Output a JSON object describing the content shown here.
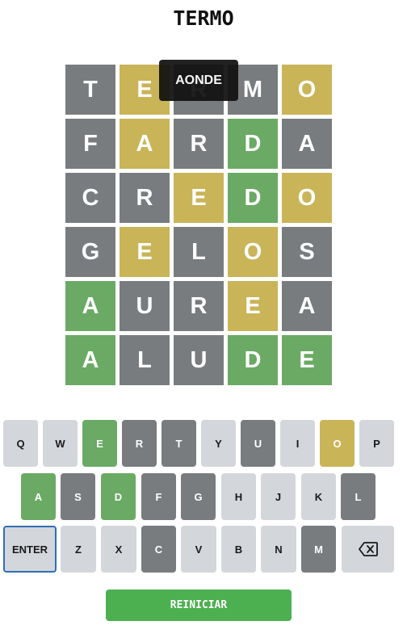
{
  "title": "TERMO",
  "toast": "AONDE",
  "board": {
    "rows": [
      [
        {
          "letter": "T",
          "state": "absent"
        },
        {
          "letter": "E",
          "state": "present"
        },
        {
          "letter": "R",
          "state": "absent"
        },
        {
          "letter": "M",
          "state": "absent"
        },
        {
          "letter": "O",
          "state": "present"
        }
      ],
      [
        {
          "letter": "F",
          "state": "absent"
        },
        {
          "letter": "A",
          "state": "present"
        },
        {
          "letter": "R",
          "state": "absent"
        },
        {
          "letter": "D",
          "state": "correct"
        },
        {
          "letter": "A",
          "state": "absent"
        }
      ],
      [
        {
          "letter": "C",
          "state": "absent"
        },
        {
          "letter": "R",
          "state": "absent"
        },
        {
          "letter": "E",
          "state": "present"
        },
        {
          "letter": "D",
          "state": "correct"
        },
        {
          "letter": "O",
          "state": "present"
        }
      ],
      [
        {
          "letter": "G",
          "state": "absent"
        },
        {
          "letter": "E",
          "state": "present"
        },
        {
          "letter": "L",
          "state": "absent"
        },
        {
          "letter": "O",
          "state": "present"
        },
        {
          "letter": "S",
          "state": "absent"
        }
      ],
      [
        {
          "letter": "A",
          "state": "correct"
        },
        {
          "letter": "U",
          "state": "absent"
        },
        {
          "letter": "R",
          "state": "absent"
        },
        {
          "letter": "E",
          "state": "present"
        },
        {
          "letter": "A",
          "state": "absent"
        }
      ],
      [
        {
          "letter": "A",
          "state": "correct"
        },
        {
          "letter": "L",
          "state": "absent"
        },
        {
          "letter": "U",
          "state": "absent"
        },
        {
          "letter": "D",
          "state": "correct"
        },
        {
          "letter": "E",
          "state": "correct"
        }
      ]
    ]
  },
  "keyboard": {
    "rows": [
      [
        {
          "label": "Q",
          "state": "unused"
        },
        {
          "label": "W",
          "state": "unused"
        },
        {
          "label": "E",
          "state": "correct"
        },
        {
          "label": "R",
          "state": "absent"
        },
        {
          "label": "T",
          "state": "absent"
        },
        {
          "label": "Y",
          "state": "unused"
        },
        {
          "label": "U",
          "state": "absent"
        },
        {
          "label": "I",
          "state": "unused"
        },
        {
          "label": "O",
          "state": "present"
        },
        {
          "label": "P",
          "state": "unused"
        }
      ],
      [
        {
          "label": "A",
          "state": "correct"
        },
        {
          "label": "S",
          "state": "absent"
        },
        {
          "label": "D",
          "state": "correct"
        },
        {
          "label": "F",
          "state": "absent"
        },
        {
          "label": "G",
          "state": "absent"
        },
        {
          "label": "H",
          "state": "unused"
        },
        {
          "label": "J",
          "state": "unused"
        },
        {
          "label": "K",
          "state": "unused"
        },
        {
          "label": "L",
          "state": "absent"
        }
      ],
      [
        {
          "label": "ENTER",
          "state": "unused",
          "kind": "enter"
        },
        {
          "label": "Z",
          "state": "unused"
        },
        {
          "label": "X",
          "state": "unused"
        },
        {
          "label": "C",
          "state": "absent"
        },
        {
          "label": "V",
          "state": "unused"
        },
        {
          "label": "B",
          "state": "unused"
        },
        {
          "label": "N",
          "state": "unused"
        },
        {
          "label": "M",
          "state": "absent"
        },
        {
          "label": "",
          "state": "unused",
          "kind": "backspace",
          "icon": "backspace-icon"
        }
      ]
    ]
  },
  "restart_label": "REINICIAR"
}
